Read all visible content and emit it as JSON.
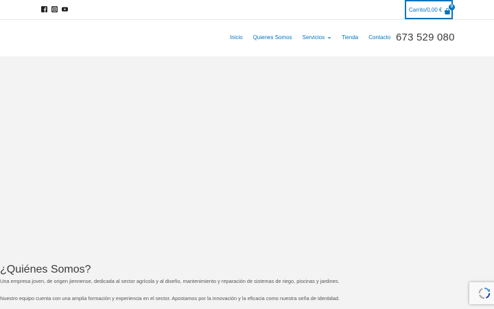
{
  "topbar": {
    "social": [
      {
        "name": "facebook",
        "icon": "facebook-icon"
      },
      {
        "name": "instagram",
        "icon": "instagram-icon"
      },
      {
        "name": "youtube",
        "icon": "youtube-icon"
      }
    ],
    "cart": {
      "label": "Carrito/0,00 €",
      "count": "0",
      "icon": "shopping-bag-icon"
    }
  },
  "header": {
    "nav": [
      "Inicio",
      "Quienes Somos",
      "Servicios",
      "Tienda",
      "Contacto"
    ],
    "phone": "673 529 080"
  },
  "about": {
    "title": "¿Quiénes Somos?",
    "paragraph1": "Una empresa joven, de origen jiennense, dedicada al sector agrícola y al diseño, mantenimiento y reparación de sistemas de riego, piscinas y jardines.",
    "paragraph2": "Nuestro equipo cuenta con una amplia formación y experiencia en el sector. Apostamos por la innovación y la eficacia como nuestra seña de identidad."
  },
  "colors": {
    "accent": "#0274be",
    "text": "#3a3a3a",
    "background": "#f3f3f3"
  }
}
